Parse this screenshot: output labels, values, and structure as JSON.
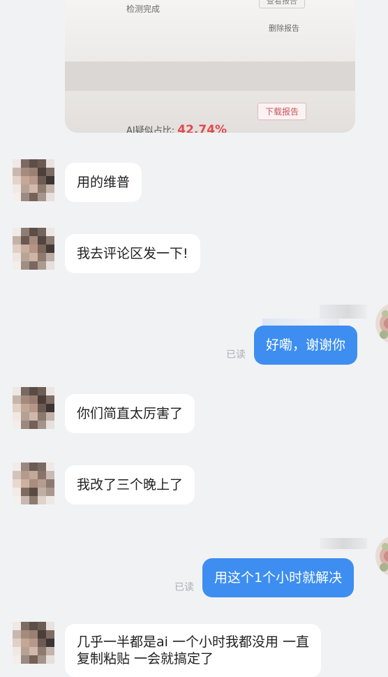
{
  "shared_image": {
    "detect_done": "检测完成",
    "view_report": "查看报告",
    "delete_report": "删除报告",
    "download_report": "下载报告",
    "ai_ratio_label": "AI疑似占比:",
    "ai_ratio_value": "42.74%"
  },
  "messages": [
    {
      "side": "in",
      "text": "用的维普"
    },
    {
      "side": "in",
      "text": "我去评论区发一下!"
    },
    {
      "side": "out",
      "text": "好嘞，谢谢你",
      "status": "已读"
    },
    {
      "side": "in",
      "text": "你们简直太厉害了"
    },
    {
      "side": "in",
      "text": "我改了三个晚上了"
    },
    {
      "side": "out",
      "text": "用这个1个小时就解决",
      "status": "已读"
    },
    {
      "side": "in",
      "text_line1": "几乎一半都是ai  一个小时我都没用 一直",
      "text_line2": "复制粘贴 一会就搞定了"
    }
  ],
  "colors": {
    "background": "#f1f2f4",
    "outgoing_bubble": "#3d8ef0",
    "incoming_bubble": "#ffffff",
    "ratio_red": "#e04a4f"
  }
}
